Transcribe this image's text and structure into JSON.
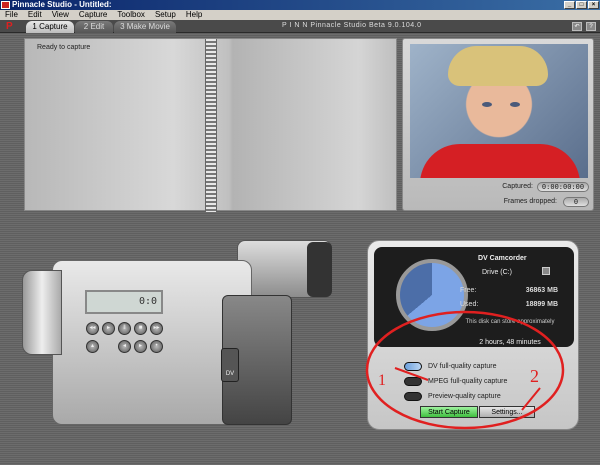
{
  "window": {
    "title": "Pinnacle Studio - Untitled:"
  },
  "menu": [
    "File",
    "Edit",
    "View",
    "Capture",
    "Toolbox",
    "Setup",
    "Help"
  ],
  "tabs": [
    {
      "label": "1 Capture",
      "active": true
    },
    {
      "label": "2 Edit",
      "active": false
    },
    {
      "label": "3 Make Movie",
      "active": false
    }
  ],
  "studio": {
    "brand": "P I N N",
    "version": "Pinnacle Studio Beta 9.0.104.0"
  },
  "album": {
    "status": "Ready to capture"
  },
  "preview": {
    "captured_label": "Captured:",
    "captured_value": "0:00:00:00",
    "dropped_label": "Frames dropped:",
    "dropped_value": "0"
  },
  "camcorder": {
    "lcd": "0:0",
    "dv_label": "DV"
  },
  "dv_panel": {
    "title": "DV Camcorder",
    "drive": "Drive (C:)",
    "free_label": "Free:",
    "free_value": "36863 MB",
    "used_label": "Used:",
    "used_value": "18899 MB",
    "note": "This disk can store approximately",
    "duration": "2 hours, 48 minutes",
    "options": [
      {
        "label": "DV full-quality capture",
        "on": true
      },
      {
        "label": "MPEG full-quality capture",
        "on": false
      },
      {
        "label": "Preview-quality capture",
        "on": false
      }
    ],
    "start_label": "Start Capture",
    "settings_label": "Settings..."
  },
  "annotations": [
    "1",
    "2"
  ],
  "colors": {
    "accent": "#0a246a",
    "gauge_free": "#7ca4e6",
    "start_green": "#3fbf3f",
    "annotation_red": "#e02020"
  }
}
